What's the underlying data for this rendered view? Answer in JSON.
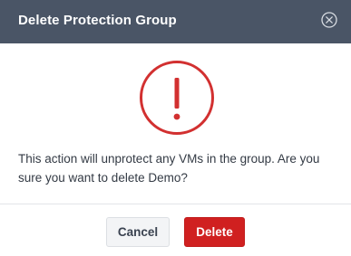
{
  "dialog": {
    "title": "Delete Protection Group",
    "message": "This action will unprotect any VMs in the group. Are you sure you want to delete Demo?",
    "icons": {
      "close": "close-circle-icon",
      "warning": "exclamation-circle-icon"
    },
    "buttons": {
      "cancel_label": "Cancel",
      "delete_label": "Delete"
    },
    "colors": {
      "header_bg": "#4a5566",
      "danger": "#d02020",
      "warning_icon": "#d23030"
    }
  }
}
